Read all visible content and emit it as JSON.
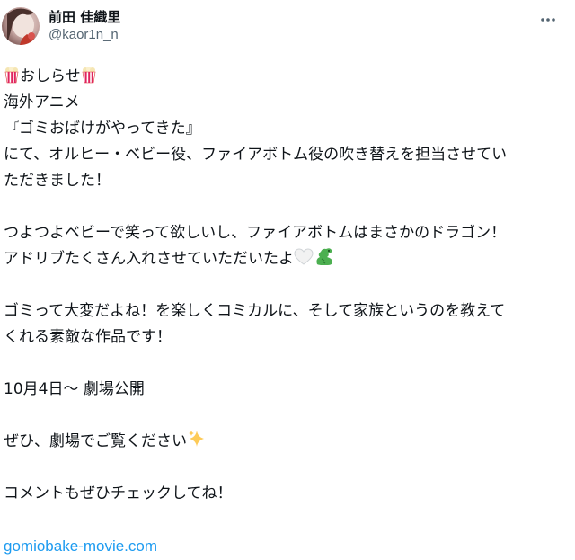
{
  "author": {
    "display_name": "前田 佳織里",
    "handle": "@kaor1n_n",
    "avatar_icon": "profile-photo"
  },
  "more_icon": "more-horizontal-icon",
  "tweet": {
    "line1_text": "おしらせ",
    "line1_emoji": "popcorn",
    "line2": "海外アニメ",
    "line3": "『ゴミおばけがやってきた』",
    "line4": "にて、オルヒー・ベビー役、ファイアボトム役の吹き替えを担当させてい",
    "line5": "ただきました！",
    "line6": "つよつよベビーで笑って欲しいし、ファイアボトムはまさかのドラゴン！",
    "line7_text": "アドリブたくさん入れさせていただいたよ",
    "line7_emojis": [
      "white-heart",
      "dragon"
    ],
    "line8": "ゴミって大変だよね！を楽しくコミカルに、そして家族というのを教えて",
    "line9": "くれる素敵な作品です！",
    "line10": "10月4日〜 劇場公開",
    "line11_text": "ぜひ、劇場でご覧ください",
    "line11_emoji": "sparkles",
    "line12": "コメントもぜひチェックしてね！",
    "link": "gomiobake-movie.com"
  },
  "colors": {
    "text": "#0f1419",
    "secondary": "#536471",
    "link": "#1d9bf0",
    "divider": "#e6e9ec"
  }
}
